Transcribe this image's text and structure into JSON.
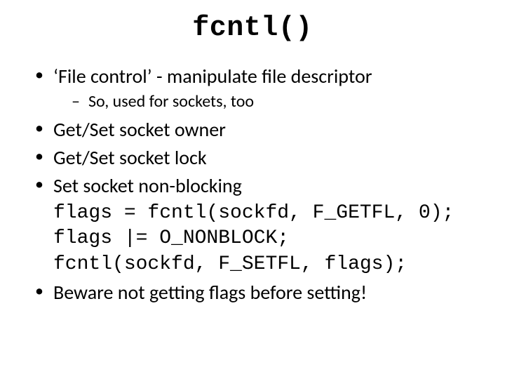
{
  "title": "fcntl()",
  "bullets": {
    "b1": "‘File control’  - manipulate file descriptor",
    "b1_sub1": "So, used for sockets, too",
    "b2": "Get/Set socket owner",
    "b3": "Get/Set socket lock",
    "b4": "Set socket non-blocking",
    "b5": "Beware not getting flags before setting!"
  },
  "code": {
    "l1": "flags = fcntl(sockfd, F_GETFL, 0);",
    "l2": "flags |= O_NONBLOCK;",
    "l3": "fcntl(sockfd, F_SETFL, flags);"
  }
}
